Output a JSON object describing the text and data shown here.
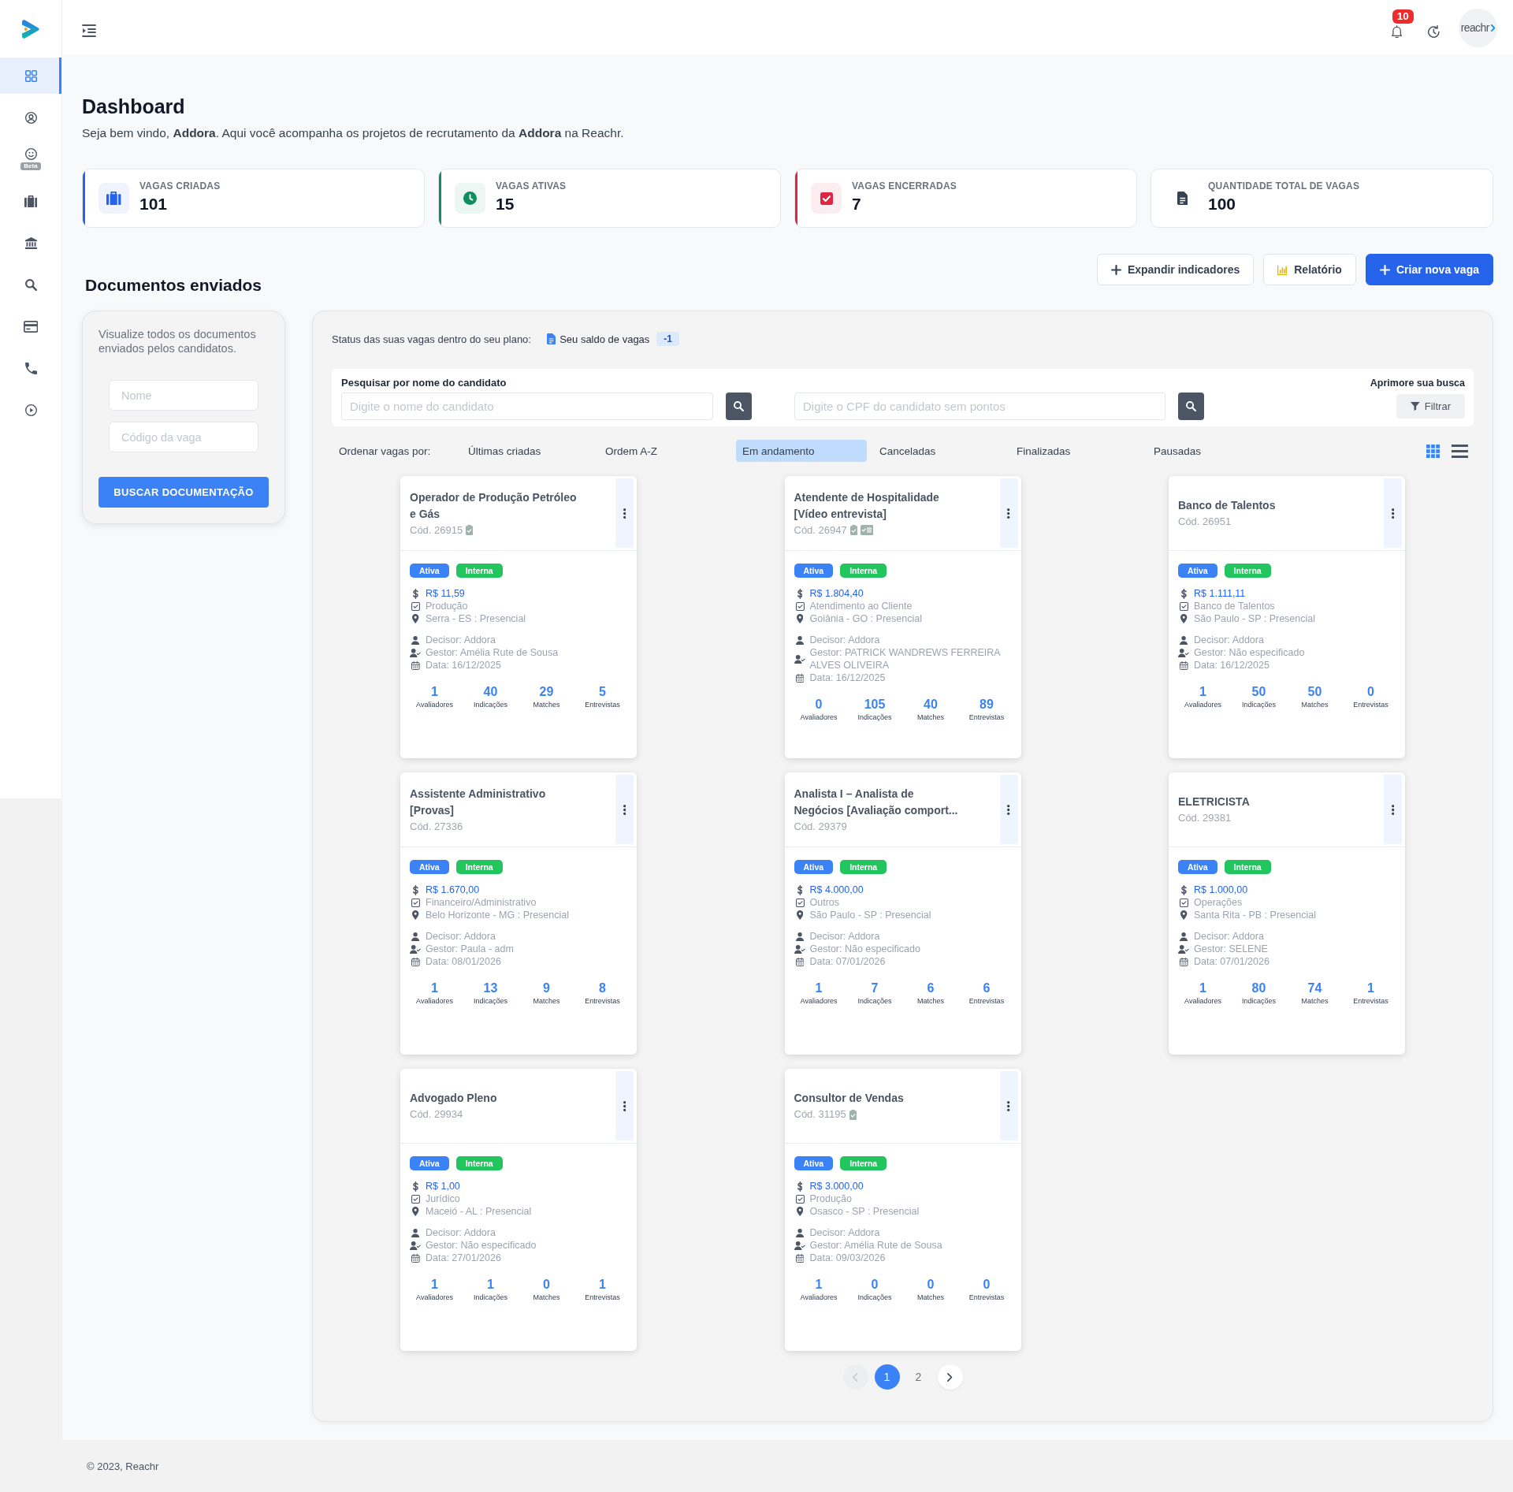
{
  "sidebar": {
    "items": [
      {
        "kind": "grid",
        "selected": true
      },
      {
        "kind": "user-circle",
        "selected": false
      },
      {
        "kind": "smile",
        "selected": false,
        "badge": "Beta"
      },
      {
        "kind": "suitcase",
        "selected": false
      },
      {
        "kind": "bank",
        "selected": false
      },
      {
        "kind": "search",
        "selected": false
      },
      {
        "kind": "card",
        "selected": false
      },
      {
        "kind": "phone",
        "selected": false
      },
      {
        "kind": "play",
        "selected": false
      }
    ]
  },
  "header": {
    "notifications": "10",
    "avatar": "reachr"
  },
  "page": {
    "title": "Dashboard",
    "subtitle": "Seja bem vindo, **Addora**. Aqui você acompanha os projetos de recrutamento da **Addora** na Reachr."
  },
  "stats": [
    {
      "label": "VAGAS CRIADAS",
      "value": "101",
      "kind": "suitcase",
      "color": "#2563eb"
    },
    {
      "label": "VAGAS ATIVAS",
      "value": "15",
      "kind": "clock",
      "color": "#0f8f5f"
    },
    {
      "label": "VAGAS ENCERRADAS",
      "value": "7",
      "kind": "check",
      "color": "#dc2643"
    },
    {
      "label": "QUANTIDADE TOTAL DE VAGAS",
      "value": "100",
      "kind": "document"
    }
  ],
  "actions": [
    {
      "label": "Expandir indicadores",
      "kind": "plus",
      "primary": false
    },
    {
      "label": "Relatório",
      "kind": "chart",
      "primary": false
    },
    {
      "label": "Criar nova vaga",
      "kind": "plus",
      "primary": true
    }
  ],
  "documents": {
    "title": "Documentos enviados",
    "description": "Visualize todos os documentos enviados pelos candidatos.",
    "fields": [
      {
        "placeholder": "Nome"
      },
      {
        "placeholder": "Código da vaga"
      }
    ],
    "button": "BUSCAR DOCUMENTAÇÃO"
  },
  "jobs": {
    "status": {
      "text": "Status das suas vagas dentro do seu plano:",
      "balance_label": "Seu saldo de vagas",
      "balance": "-1"
    },
    "search": {
      "label": "Pesquisar por nome do candidato",
      "name_placeholder": "Digite o nome do candidato",
      "cpf_placeholder": "Digite o CPF do candidato sem pontos",
      "refine_label": "Aprimore sua busca",
      "filter_button": "Filtrar"
    },
    "sort": {
      "label": "Ordenar vagas por:",
      "options": [
        {
          "label": "Últimas criadas",
          "selected": false
        },
        {
          "label": "Ordem A-Z",
          "selected": false
        },
        {
          "label": "Em andamento",
          "selected": true
        },
        {
          "label": "Canceladas",
          "selected": false
        },
        {
          "label": "Finalizadas",
          "selected": false
        },
        {
          "label": "Pausadas",
          "selected": false
        }
      ]
    },
    "view_modes": [
      {
        "kind": "grid",
        "selected": true
      },
      {
        "kind": "list",
        "selected": false
      }
    ],
    "cards": [
      {
        "title": "Operador de Produção Petróleo e Gás",
        "code": "Cód. 26915",
        "code_marks": [
          {
            "kind": "clipboard"
          }
        ],
        "tags": [
          {
            "label": "Ativa",
            "color": "#3b82f6"
          },
          {
            "label": "Interna",
            "color": "#22c55e"
          }
        ],
        "salary": "R$ 11,59",
        "area": "Produção",
        "location": "Serra - ES : Presencial",
        "decisor": "Decisor: Addora",
        "gestor": "Gestor: Amélia Rute de Sousa",
        "date": "Data: 16/12/2025",
        "stats": [
          {
            "value": "1",
            "label": "Avaliadores"
          },
          {
            "value": "40",
            "label": "Indicações"
          },
          {
            "value": "29",
            "label": "Matches"
          },
          {
            "value": "5",
            "label": "Entrevistas"
          }
        ]
      },
      {
        "title": "Atendente de Hospitalidade [Vídeo entrevista]",
        "code": "Cód. 26947",
        "code_marks": [
          {
            "kind": "clipboard"
          },
          {
            "kind": "checklist"
          }
        ],
        "tags": [
          {
            "label": "Ativa",
            "color": "#3b82f6"
          },
          {
            "label": "Interna",
            "color": "#22c55e"
          }
        ],
        "salary": "R$ 1.804,40",
        "area": "Atendimento ao Cliente",
        "location": "Goiânia - GO : Presencial",
        "decisor": "Decisor: Addora",
        "gestor": "Gestor: PATRICK WANDREWS FERREIRA ALVES OLIVEIRA",
        "date": "Data: 16/12/2025",
        "stats": [
          {
            "value": "0",
            "label": "Avaliadores"
          },
          {
            "value": "105",
            "label": "Indicações"
          },
          {
            "value": "40",
            "label": "Matches"
          },
          {
            "value": "89",
            "label": "Entrevistas"
          }
        ]
      },
      {
        "title": "Banco de Talentos",
        "code": "Cód. 26951",
        "tags": [
          {
            "label": "Ativa",
            "color": "#3b82f6"
          },
          {
            "label": "Interna",
            "color": "#22c55e"
          }
        ],
        "salary": "R$ 1.111,11",
        "area": "Banco de Talentos",
        "location": "São Paulo - SP : Presencial",
        "decisor": "Decisor: Addora",
        "gestor": "Gestor: Não especificado",
        "date": "Data: 16/12/2025",
        "stats": [
          {
            "value": "1",
            "label": "Avaliadores"
          },
          {
            "value": "50",
            "label": "Indicações"
          },
          {
            "value": "50",
            "label": "Matches"
          },
          {
            "value": "0",
            "label": "Entrevistas"
          }
        ]
      },
      {
        "title": "Assistente Administrativo [Provas]",
        "code": "Cód. 27336",
        "tags": [
          {
            "label": "Ativa",
            "color": "#3b82f6"
          },
          {
            "label": "Interna",
            "color": "#22c55e"
          }
        ],
        "salary": "R$ 1.670,00",
        "area": "Financeiro/Administrativo",
        "location": "Belo Horizonte - MG : Presencial",
        "decisor": "Decisor: Addora",
        "gestor": "Gestor: Paula - adm",
        "date": "Data: 08/01/2026",
        "stats": [
          {
            "value": "1",
            "label": "Avaliadores"
          },
          {
            "value": "13",
            "label": "Indicações"
          },
          {
            "value": "9",
            "label": "Matches"
          },
          {
            "value": "8",
            "label": "Entrevistas"
          }
        ]
      },
      {
        "title": "Analista I – Analista de Negócios [Avaliação comport...",
        "code": "Cód. 29379",
        "tags": [
          {
            "label": "Ativa",
            "color": "#3b82f6"
          },
          {
            "label": "Interna",
            "color": "#22c55e"
          }
        ],
        "salary": "R$ 4.000,00",
        "area": "Outros",
        "location": "São Paulo - SP : Presencial",
        "decisor": "Decisor: Addora",
        "gestor": "Gestor: Não especificado",
        "date": "Data: 07/01/2026",
        "stats": [
          {
            "value": "1",
            "label": "Avaliadores"
          },
          {
            "value": "7",
            "label": "Indicações"
          },
          {
            "value": "6",
            "label": "Matches"
          },
          {
            "value": "6",
            "label": "Entrevistas"
          }
        ]
      },
      {
        "title": "ELETRICISTA",
        "code": "Cód. 29381",
        "tags": [
          {
            "label": "Ativa",
            "color": "#3b82f6"
          },
          {
            "label": "Interna",
            "color": "#22c55e"
          }
        ],
        "salary": "R$ 1.000,00",
        "area": "Operações",
        "location": "Santa Rita - PB : Presencial",
        "decisor": "Decisor: Addora",
        "gestor": "Gestor: SELENE",
        "date": "Data: 07/01/2026",
        "stats": [
          {
            "value": "1",
            "label": "Avaliadores"
          },
          {
            "value": "80",
            "label": "Indicações"
          },
          {
            "value": "74",
            "label": "Matches"
          },
          {
            "value": "1",
            "label": "Entrevistas"
          }
        ]
      },
      {
        "title": "Advogado Pleno",
        "code": "Cód. 29934",
        "tags": [
          {
            "label": "Ativa",
            "color": "#3b82f6"
          },
          {
            "label": "Interna",
            "color": "#22c55e"
          }
        ],
        "salary": "R$ 1,00",
        "area": "Jurídico",
        "location": "Maceió - AL : Presencial",
        "decisor": "Decisor: Addora",
        "gestor": "Gestor: Não especificado",
        "date": "Data: 27/01/2026",
        "stats": [
          {
            "value": "1",
            "label": "Avaliadores"
          },
          {
            "value": "1",
            "label": "Indicações"
          },
          {
            "value": "0",
            "label": "Matches"
          },
          {
            "value": "1",
            "label": "Entrevistas"
          }
        ]
      },
      {
        "title": "Consultor de Vendas",
        "code": "Cód. 31195",
        "code_marks": [
          {
            "kind": "clipboard"
          }
        ],
        "tags": [
          {
            "label": "Ativa",
            "color": "#3b82f6"
          },
          {
            "label": "Interna",
            "color": "#22c55e"
          }
        ],
        "salary": "R$ 3.000,00",
        "area": "Produção",
        "location": "Osasco - SP : Presencial",
        "decisor": "Decisor: Addora",
        "gestor": "Gestor: Amélia Rute de Sousa",
        "date": "Data: 09/03/2026",
        "stats": [
          {
            "value": "1",
            "label": "Avaliadores"
          },
          {
            "value": "0",
            "label": "Indicações"
          },
          {
            "value": "0",
            "label": "Matches"
          },
          {
            "value": "0",
            "label": "Entrevistas"
          }
        ]
      }
    ],
    "pagination": {
      "prev": {
        "disabled": true
      },
      "pages": [
        {
          "label": "1",
          "selected": true
        },
        {
          "label": "2",
          "selected": false
        }
      ],
      "next": {
        "disabled": false
      }
    }
  },
  "footer": "© 2023, Reachr"
}
